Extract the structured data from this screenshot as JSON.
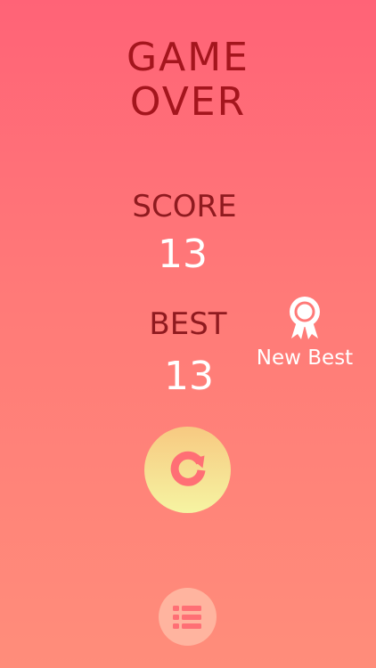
{
  "title": {
    "line1": "GAME",
    "line2": "OVER"
  },
  "score": {
    "label": "SCORE",
    "value": "13"
  },
  "best": {
    "label": "BEST",
    "value": "13"
  },
  "new_best": {
    "label": "New Best",
    "icon": "ribbon-award-icon"
  },
  "buttons": {
    "replay_icon": "replay-icon",
    "menu_icon": "list-menu-icon"
  },
  "colors": {
    "background_top": "#ff6377",
    "background_bottom": "#ff8d7a",
    "title": "#a4151d",
    "label": "#8f1a1f",
    "value": "#ffffff",
    "replay_button": "#f6e29a",
    "replay_icon": "#ff6f75",
    "menu_button": "#ffb49f",
    "menu_icon": "#ff6f75"
  }
}
